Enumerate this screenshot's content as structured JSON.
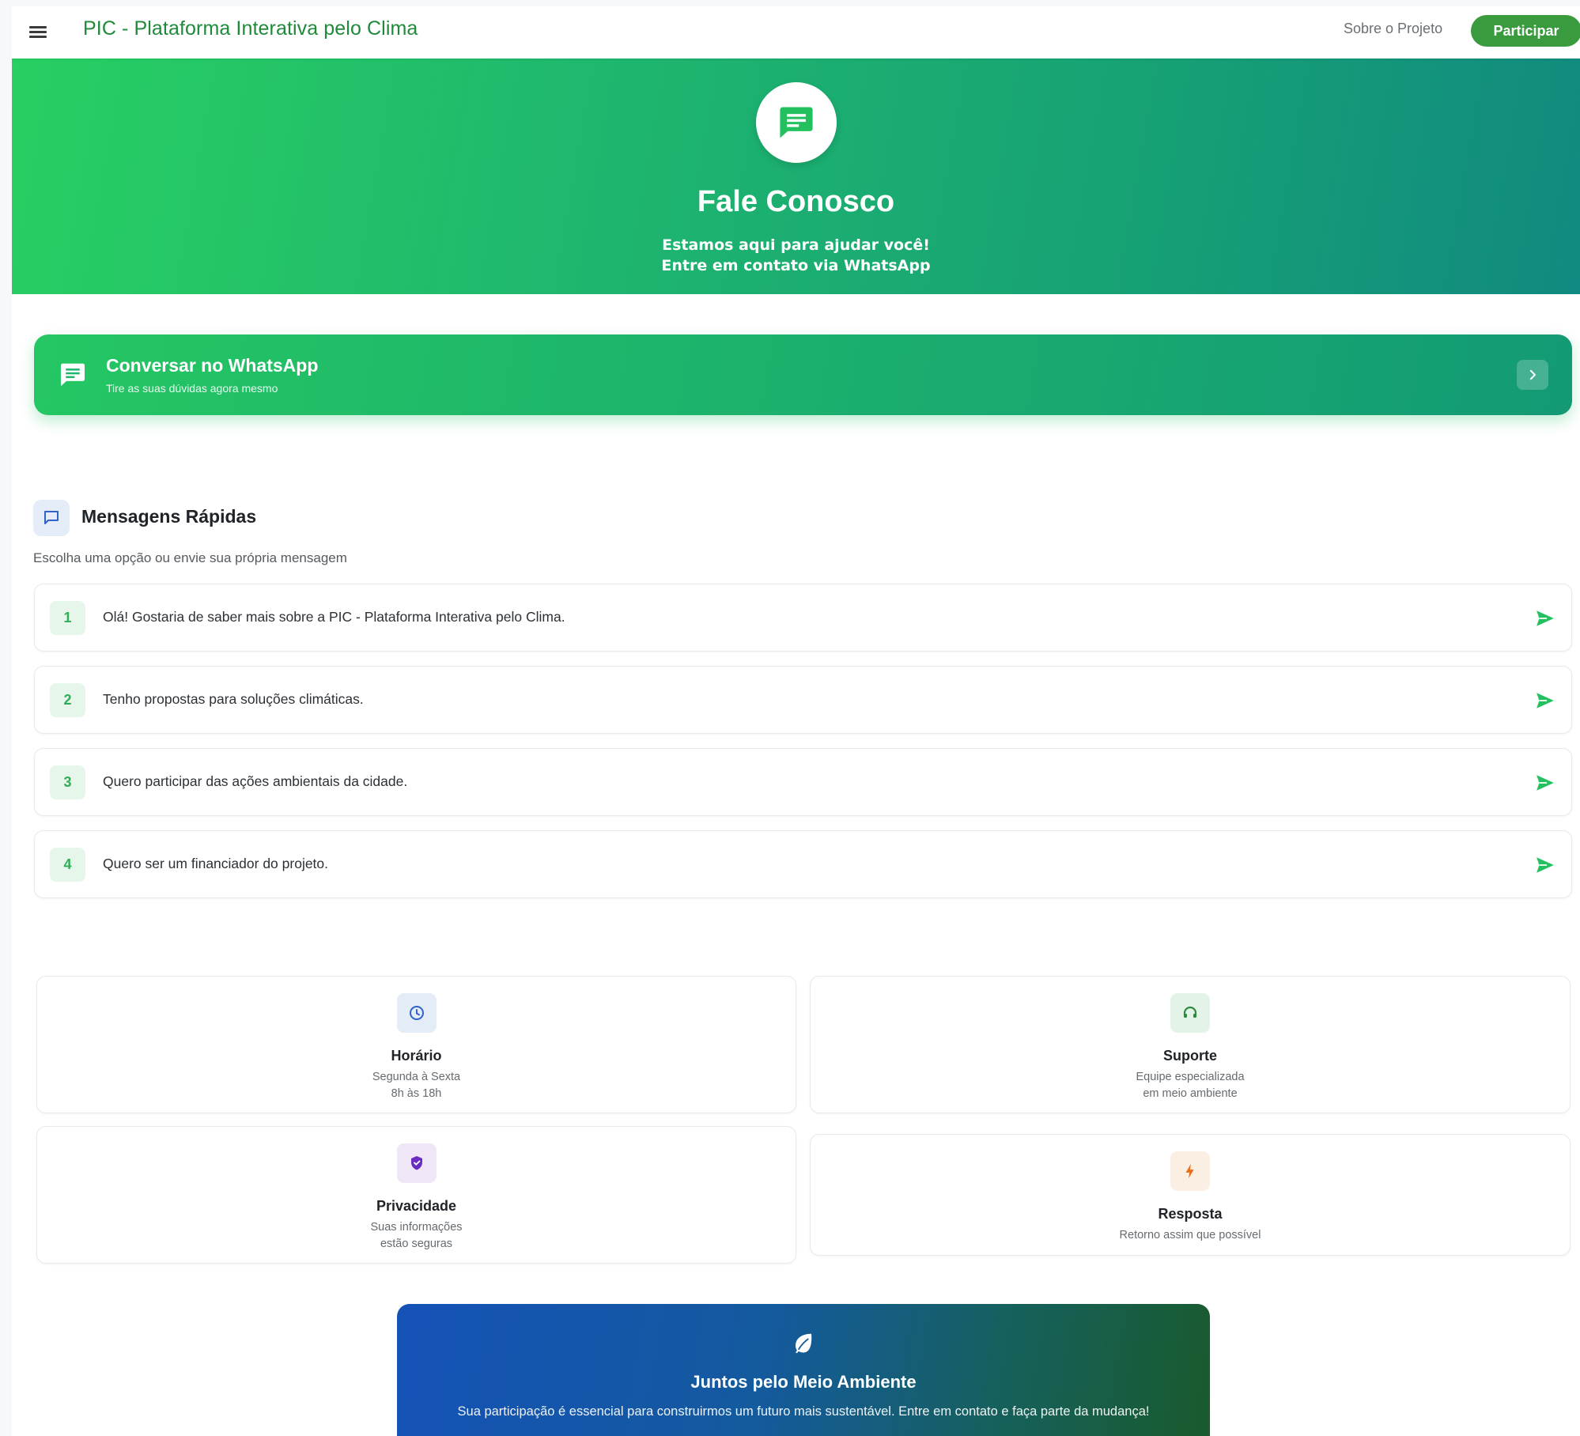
{
  "header": {
    "app_title": "PIC - Plataforma Interativa pelo Clima",
    "nav_about": "Sobre o Projeto",
    "nav_join": "Participar"
  },
  "hero": {
    "icon": "chat-message-icon",
    "title": "Fale Conosco",
    "subtitle_line1": "Estamos aqui para ajudar você!",
    "subtitle_line2": "Entre em contato via WhatsApp"
  },
  "cta": {
    "icon": "chat-message-icon",
    "title": "Conversar no WhatsApp",
    "subtitle": "Tire as suas dúvidas agora mesmo",
    "arrow_icon": "chevron-right-icon"
  },
  "quick_messages": {
    "icon": "chat-bubble-icon",
    "title": "Mensagens Rápidas",
    "subtitle": "Escolha uma opção ou envie sua própria mensagem",
    "items": [
      {
        "number": "1",
        "text": "Olá! Gostaria de saber mais sobre a PIC - Plataforma Interativa pelo Clima."
      },
      {
        "number": "2",
        "text": "Tenho propostas para soluções climáticas."
      },
      {
        "number": "3",
        "text": "Quero participar das ações ambientais da cidade."
      },
      {
        "number": "4",
        "text": "Quero ser um financiador do projeto."
      }
    ]
  },
  "info_cards": [
    {
      "icon": "clock-icon",
      "title": "Horário",
      "line1": "Segunda à Sexta",
      "line2": "8h às 18h"
    },
    {
      "icon": "headset-icon",
      "title": "Suporte",
      "line1": "Equipe especializada",
      "line2": "em meio ambiente"
    },
    {
      "icon": "shield-icon",
      "title": "Privacidade",
      "line1": "Suas informações",
      "line2": "estão seguras"
    },
    {
      "icon": "lightning-icon",
      "title": "Resposta",
      "line1": "Retorno assim que possível"
    }
  ],
  "banner": {
    "icon": "leaf-icon",
    "title": "Juntos pelo Meio Ambiente",
    "text": "Sua participação é essencial para construirmos um futuro mais sustentável. Entre em contato e faça parte da mudança!"
  },
  "colors": {
    "brand_green": "#1f8a3a",
    "accent_green": "#2fae55",
    "button_green": "#3a9a3e"
  }
}
